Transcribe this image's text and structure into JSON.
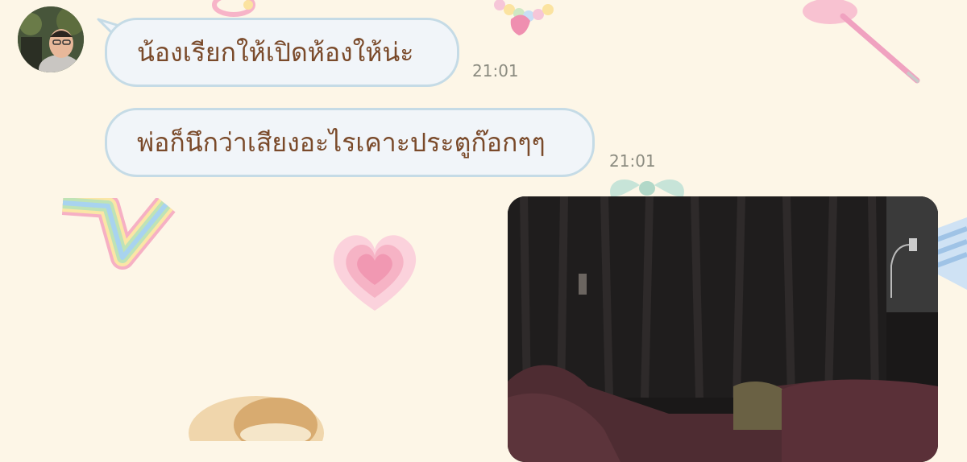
{
  "chat": {
    "messages": [
      {
        "text": "น้องเรียกให้เปิดห้องให้น่ะ",
        "time": "21:01"
      },
      {
        "text": "พ่อก็นึกว่าเสียงอะไรเคาะประตูก๊อกๆๆ",
        "time": "21:01"
      }
    ],
    "photo": {
      "icon": "photo-bedroom"
    }
  },
  "theme": {
    "background": "#fdf6e7",
    "bubble_fill": "#f1f5f9",
    "bubble_border": "#c5dbe6",
    "text_color": "#7a4a2a"
  }
}
